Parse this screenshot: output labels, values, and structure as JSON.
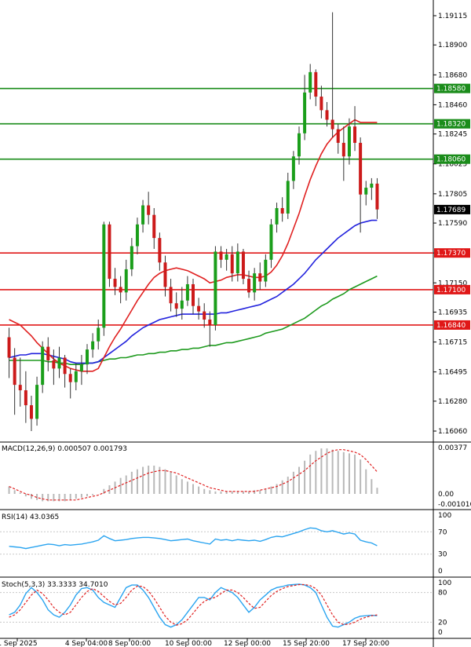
{
  "chart_data": {
    "type": "candlestick",
    "symbol_pair": "EURUSD",
    "main_price_ticks": [
      "1.19115",
      "1.18900",
      "1.18680",
      "1.18460",
      "1.18245",
      "1.18025",
      "1.17805",
      "1.17590",
      "1.17370",
      "1.17150",
      "1.16935",
      "1.16715",
      "1.16495",
      "1.16280",
      "1.16060"
    ],
    "current_price": "1.17689",
    "levels": [
      {
        "price": "1.18580",
        "color": "#1a8c1a"
      },
      {
        "price": "1.18320",
        "color": "#1a8c1a"
      },
      {
        "price": "1.18060",
        "color": "#1a8c1a"
      },
      {
        "price": "1.17370",
        "color": "#e01818"
      },
      {
        "price": "1.17100",
        "color": "#e01818"
      },
      {
        "price": "1.16840",
        "color": "#e01818"
      }
    ],
    "x_ticks": [
      "1 Sep 2025",
      "4 Sep 04:00",
      "8 Sep 00:00",
      "10 Sep 00:00",
      "12 Sep 00:00",
      "15 Sep 20:00",
      "17 Sep 20:00"
    ],
    "candles": [
      [
        1.1675,
        1.166,
        1.1682,
        1.1645
      ],
      [
        1.166,
        1.164,
        1.1667,
        1.1618
      ],
      [
        1.164,
        1.1636,
        1.166,
        1.1624
      ],
      [
        1.1636,
        1.1625,
        1.165,
        1.1612
      ],
      [
        1.1625,
        1.1615,
        1.1632,
        1.1606
      ],
      [
        1.1615,
        1.164,
        1.1646,
        1.161
      ],
      [
        1.164,
        1.1668,
        1.1672,
        1.1634
      ],
      [
        1.1668,
        1.1658,
        1.1675,
        1.165
      ],
      [
        1.1658,
        1.1652,
        1.1666,
        1.164
      ],
      [
        1.1652,
        1.166,
        1.1668,
        1.1645
      ],
      [
        1.166,
        1.1648,
        1.1662,
        1.1638
      ],
      [
        1.1648,
        1.1642,
        1.1652,
        1.163
      ],
      [
        1.1642,
        1.165,
        1.1656,
        1.1636
      ],
      [
        1.165,
        1.1655,
        1.1662,
        1.164
      ],
      [
        1.1655,
        1.1666,
        1.167,
        1.1648
      ],
      [
        1.1666,
        1.1672,
        1.1678,
        1.166
      ],
      [
        1.1672,
        1.1682,
        1.1688,
        1.1666
      ],
      [
        1.1682,
        1.1758,
        1.176,
        1.1676
      ],
      [
        1.1758,
        1.1718,
        1.176,
        1.1712
      ],
      [
        1.1718,
        1.1712,
        1.1726,
        1.1706
      ],
      [
        1.1712,
        1.1708,
        1.172,
        1.17
      ],
      [
        1.1708,
        1.1725,
        1.1732,
        1.1702
      ],
      [
        1.1725,
        1.1742,
        1.1748,
        1.172
      ],
      [
        1.1742,
        1.1758,
        1.1763,
        1.1736
      ],
      [
        1.1758,
        1.1772,
        1.1776,
        1.1752
      ],
      [
        1.1772,
        1.1765,
        1.1782,
        1.1758
      ],
      [
        1.1765,
        1.1748,
        1.177,
        1.174
      ],
      [
        1.1748,
        1.173,
        1.1752,
        1.1724
      ],
      [
        1.173,
        1.1712,
        1.1735,
        1.1705
      ],
      [
        1.1712,
        1.17,
        1.1718,
        1.1694
      ],
      [
        1.17,
        1.1696,
        1.1708,
        1.169
      ],
      [
        1.1696,
        1.1702,
        1.1712,
        1.1688
      ],
      [
        1.1702,
        1.1714,
        1.172,
        1.1698
      ],
      [
        1.1714,
        1.1698,
        1.1718,
        1.1692
      ],
      [
        1.1698,
        1.1694,
        1.1704,
        1.1688
      ],
      [
        1.1694,
        1.1688,
        1.17,
        1.1682
      ],
      [
        1.1688,
        1.1684,
        1.1694,
        1.1668
      ],
      [
        1.1684,
        1.1738,
        1.1742,
        1.168
      ],
      [
        1.1738,
        1.1732,
        1.1742,
        1.1726
      ],
      [
        1.1732,
        1.1736,
        1.174,
        1.1724
      ],
      [
        1.1736,
        1.1722,
        1.1742,
        1.1716
      ],
      [
        1.1722,
        1.1738,
        1.1744,
        1.1716
      ],
      [
        1.1738,
        1.1718,
        1.174,
        1.1714
      ],
      [
        1.1718,
        1.1708,
        1.1724,
        1.1704
      ],
      [
        1.1708,
        1.1722,
        1.1726,
        1.1702
      ],
      [
        1.1722,
        1.1716,
        1.173,
        1.171
      ],
      [
        1.1716,
        1.1732,
        1.1736,
        1.1712
      ],
      [
        1.1732,
        1.1758,
        1.1762,
        1.1726
      ],
      [
        1.1758,
        1.177,
        1.1774,
        1.1752
      ],
      [
        1.177,
        1.1766,
        1.1778,
        1.176
      ],
      [
        1.1766,
        1.179,
        1.1796,
        1.1762
      ],
      [
        1.179,
        1.1808,
        1.1812,
        1.1784
      ],
      [
        1.1808,
        1.1825,
        1.183,
        1.1802
      ],
      [
        1.1825,
        1.1855,
        1.1868,
        1.182
      ],
      [
        1.1855,
        1.187,
        1.1876,
        1.185
      ],
      [
        1.187,
        1.1852,
        1.1872,
        1.1845
      ],
      [
        1.1852,
        1.1842,
        1.186,
        1.1836
      ],
      [
        1.1842,
        1.1835,
        1.1848,
        1.183
      ],
      [
        1.1835,
        1.1828,
        1.1914,
        1.1822
      ],
      [
        1.1828,
        1.1818,
        1.1832,
        1.181
      ],
      [
        1.1818,
        1.1808,
        1.183,
        1.179
      ],
      [
        1.1808,
        1.183,
        1.1836,
        1.1802
      ],
      [
        1.183,
        1.1818,
        1.1845,
        1.1812
      ],
      [
        1.1818,
        1.178,
        1.1822,
        1.1752
      ],
      [
        1.178,
        1.1785,
        1.179,
        1.1772
      ],
      [
        1.1785,
        1.1788,
        1.1792,
        1.1776
      ],
      [
        1.1788,
        1.1769,
        1.1792,
        1.1762
      ]
    ],
    "ma_fast_red": [
      1.1688,
      1.1686,
      1.1684,
      1.168,
      1.1676,
      1.1671,
      1.1667,
      1.1663,
      1.1659,
      1.1656,
      1.1654,
      1.1652,
      1.1651,
      1.165,
      1.165,
      1.165,
      1.1652,
      1.166,
      1.1668,
      1.1675,
      1.1681,
      1.1688,
      1.1695,
      1.1702,
      1.1708,
      1.1714,
      1.1719,
      1.1722,
      1.1724,
      1.1725,
      1.1726,
      1.1725,
      1.1724,
      1.1722,
      1.172,
      1.1718,
      1.1715,
      1.1716,
      1.1717,
      1.1719,
      1.172,
      1.1721,
      1.1721,
      1.172,
      1.1719,
      1.1719,
      1.172,
      1.1723,
      1.1728,
      1.1735,
      1.1744,
      1.1755,
      1.1766,
      1.1779,
      1.1791,
      1.1801,
      1.181,
      1.1817,
      1.1822,
      1.1826,
      1.1829,
      1.1832,
      1.1835,
      1.1833,
      1.1833,
      1.1833,
      1.1833
    ],
    "ma_mid_blue": [
      1.166,
      1.1661,
      1.1662,
      1.1662,
      1.1663,
      1.1663,
      1.1663,
      1.1662,
      1.1661,
      1.166,
      1.1659,
      1.1657,
      1.1656,
      1.1656,
      1.1656,
      1.1656,
      1.1657,
      1.166,
      1.1663,
      1.1666,
      1.1669,
      1.1672,
      1.1676,
      1.1679,
      1.1682,
      1.1684,
      1.1686,
      1.1688,
      1.1689,
      1.169,
      1.1691,
      1.1692,
      1.1692,
      1.1692,
      1.1692,
      1.1692,
      1.1692,
      1.1692,
      1.1693,
      1.1693,
      1.1694,
      1.1695,
      1.1696,
      1.1697,
      1.1698,
      1.1699,
      1.1701,
      1.1703,
      1.1705,
      1.1708,
      1.1711,
      1.1714,
      1.1718,
      1.1722,
      1.1727,
      1.1732,
      1.1736,
      1.174,
      1.1744,
      1.1748,
      1.1751,
      1.1754,
      1.1757,
      1.1759,
      1.176,
      1.1761,
      1.1761
    ],
    "ma_slow_green": [
      1.1658,
      1.1658,
      1.1658,
      1.1658,
      1.1658,
      1.1658,
      1.1658,
      1.1657,
      1.1657,
      1.1656,
      1.1656,
      1.1655,
      1.1655,
      1.1655,
      1.1656,
      1.1656,
      1.1657,
      1.1658,
      1.1659,
      1.1659,
      1.166,
      1.166,
      1.1661,
      1.1662,
      1.1662,
      1.1663,
      1.1663,
      1.1664,
      1.1664,
      1.1665,
      1.1665,
      1.1666,
      1.1666,
      1.1667,
      1.1667,
      1.1668,
      1.1669,
      1.1669,
      1.167,
      1.1671,
      1.1671,
      1.1672,
      1.1673,
      1.1674,
      1.1675,
      1.1676,
      1.1678,
      1.1679,
      1.168,
      1.1681,
      1.1683,
      1.1685,
      1.1687,
      1.1689,
      1.1692,
      1.1695,
      1.1698,
      1.17,
      1.1703,
      1.1705,
      1.1707,
      1.171,
      1.1712,
      1.1714,
      1.1716,
      1.1718,
      1.172
    ],
    "macd": {
      "label": "MACD(12,26,9) 0.000507 0.001793",
      "ticks": [
        "0.00377",
        "0.00",
        "-0.001016"
      ],
      "hist": [
        0.0006,
        0.0003,
        0.0001,
        -0.0002,
        -0.0004,
        -0.0005,
        -0.0006,
        -0.0006,
        -0.0006,
        -0.0006,
        -0.0006,
        -0.0005,
        -0.0004,
        -0.0003,
        -0.0002,
        -0.0001,
        0.0,
        0.0004,
        0.0007,
        0.001,
        0.0013,
        0.0015,
        0.0018,
        0.002,
        0.0022,
        0.0023,
        0.0023,
        0.0022,
        0.002,
        0.0018,
        0.0015,
        0.0012,
        0.001,
        0.0008,
        0.0006,
        0.0004,
        0.0003,
        0.0002,
        0.0002,
        0.0002,
        0.0002,
        0.0002,
        0.0002,
        0.0002,
        0.0003,
        0.0003,
        0.0004,
        0.0006,
        0.0008,
        0.0011,
        0.0014,
        0.0018,
        0.0022,
        0.0027,
        0.0032,
        0.0035,
        0.0037,
        0.0037,
        0.0036,
        0.0035,
        0.0034,
        0.0033,
        0.0032,
        0.0028,
        0.002,
        0.0012,
        0.0005
      ],
      "signal": [
        0.0006,
        0.0004,
        0.0002,
        0.0,
        -0.0001,
        -0.0003,
        -0.0004,
        -0.0005,
        -0.0005,
        -0.0005,
        -0.0005,
        -0.0005,
        -0.0005,
        -0.0004,
        -0.0003,
        -0.0002,
        -0.0001,
        0.0001,
        0.0003,
        0.0005,
        0.0007,
        0.0009,
        0.0011,
        0.0013,
        0.0015,
        0.0017,
        0.0018,
        0.0019,
        0.0019,
        0.0018,
        0.0017,
        0.0015,
        0.0013,
        0.0011,
        0.0009,
        0.0007,
        0.0005,
        0.0004,
        0.0003,
        0.0002,
        0.0002,
        0.0002,
        0.0002,
        0.0002,
        0.0002,
        0.0003,
        0.0004,
        0.0005,
        0.0006,
        0.0008,
        0.001,
        0.0013,
        0.0016,
        0.0019,
        0.0023,
        0.0027,
        0.003,
        0.0033,
        0.0035,
        0.0036,
        0.0036,
        0.0035,
        0.0034,
        0.0032,
        0.0028,
        0.0023,
        0.0018
      ]
    },
    "rsi": {
      "label": "RSI(14) 43.0365",
      "ticks": [
        "100",
        "70",
        "30",
        "0"
      ],
      "values": [
        44,
        43,
        42,
        40,
        42,
        44,
        46,
        48,
        47,
        45,
        47,
        46,
        47,
        48,
        50,
        52,
        55,
        63,
        58,
        54,
        55,
        56,
        58,
        59,
        60,
        60,
        59,
        58,
        56,
        54,
        55,
        56,
        57,
        54,
        52,
        50,
        48,
        57,
        55,
        56,
        54,
        56,
        55,
        54,
        55,
        53,
        56,
        60,
        62,
        61,
        64,
        67,
        70,
        74,
        77,
        76,
        72,
        70,
        72,
        69,
        66,
        68,
        66,
        55,
        52,
        50,
        45
      ]
    },
    "stoch": {
      "label": "Stoch(5,3,3) 33.3333 34.7010",
      "ticks": [
        "100",
        "80",
        "20",
        "0"
      ],
      "k": [
        35,
        40,
        55,
        78,
        90,
        80,
        65,
        45,
        35,
        30,
        40,
        55,
        75,
        88,
        90,
        85,
        70,
        60,
        55,
        50,
        70,
        90,
        95,
        95,
        85,
        70,
        50,
        30,
        15,
        10,
        15,
        25,
        40,
        55,
        70,
        70,
        65,
        80,
        90,
        85,
        80,
        70,
        55,
        40,
        50,
        65,
        75,
        85,
        90,
        92,
        95,
        96,
        97,
        95,
        90,
        80,
        55,
        30,
        12,
        10,
        15,
        20,
        28,
        32,
        33,
        34,
        33
      ],
      "d": [
        30,
        35,
        45,
        60,
        75,
        85,
        78,
        65,
        50,
        40,
        35,
        40,
        55,
        70,
        82,
        88,
        82,
        72,
        62,
        55,
        58,
        70,
        85,
        93,
        92,
        83,
        68,
        50,
        32,
        20,
        14,
        17,
        25,
        38,
        52,
        62,
        68,
        70,
        78,
        85,
        85,
        80,
        70,
        58,
        48,
        50,
        62,
        74,
        82,
        88,
        92,
        94,
        96,
        96,
        94,
        88,
        75,
        55,
        35,
        20,
        15,
        16,
        20,
        26,
        30,
        33,
        34.7
      ]
    }
  }
}
